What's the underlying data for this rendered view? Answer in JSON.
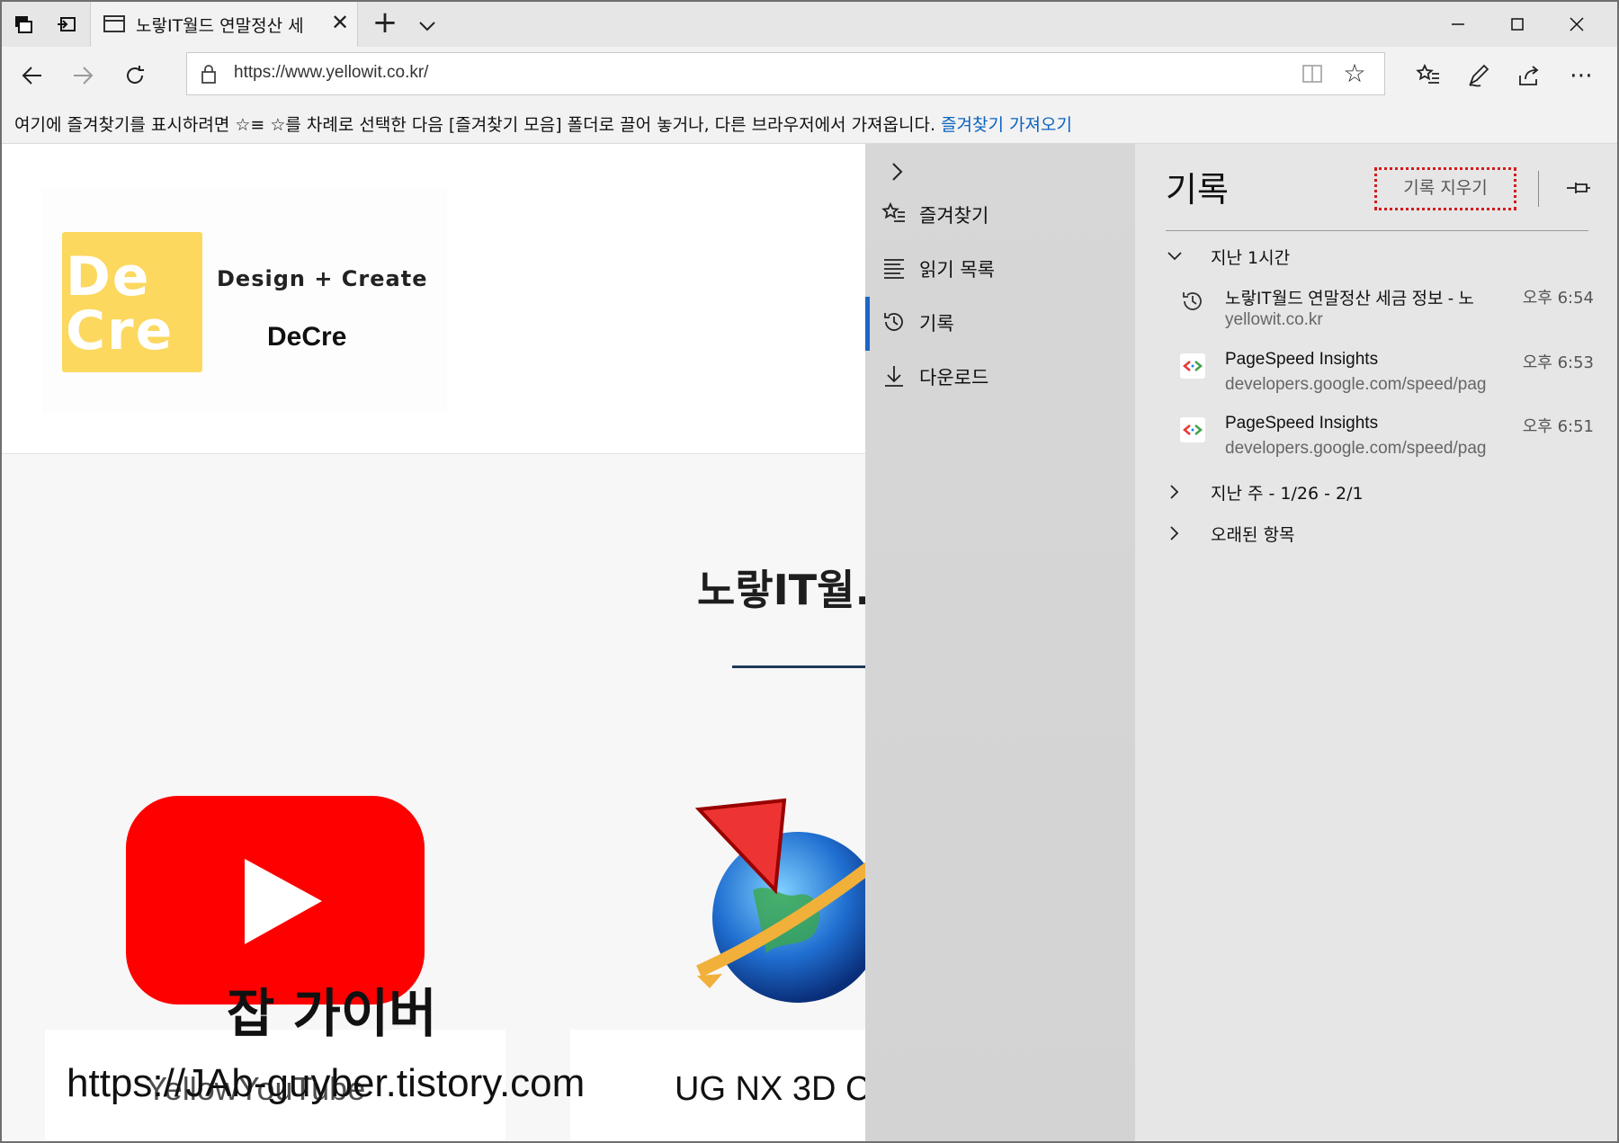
{
  "browser": {
    "tab_title": "노랗IT월드 연말정산 세",
    "url": "https://www.yellowit.co.kr/",
    "favorites_hint": "여기에 즐겨찾기를 표시하려면 ☆≡ ☆를 차례로 선택한 다음 [즐겨찾기 모음] 폴더로 끌어 놓거나, 다른 브라우저에서 가져옵니다.",
    "favorites_import": "즐겨찾기 가져오기",
    "icons": [
      "tab-actions-icon",
      "set-aside-icon",
      "page-icon",
      "close-icon",
      "plus-icon",
      "chevron-down-icon",
      "minimize-icon",
      "maximize-icon",
      "window-close-icon",
      "back-icon",
      "forward-icon",
      "refresh-icon",
      "lock-icon",
      "reading-view-icon",
      "star-icon",
      "favorites-hub-icon",
      "pen-icon",
      "share-icon",
      "more-icon"
    ]
  },
  "page": {
    "logo_letters": "De Cre",
    "logo_tag": "Design + Create",
    "logo_name": "DeCre",
    "section_title": "노랗IT월.",
    "yt_caption": "잡 가이버",
    "card1_text": "YellowYouTube",
    "watermark": "https://JAb-guyber.tistory.com",
    "card2_text": "UG NX 3D C",
    "accent": "#fcd85f",
    "youtube_red": "#ff0000"
  },
  "hub": {
    "nav": [
      {
        "label": "즐겨찾기",
        "icon": "favorites-icon"
      },
      {
        "label": "읽기 목록",
        "icon": "reading-list-icon"
      },
      {
        "label": "기록",
        "icon": "history-icon"
      },
      {
        "label": "다운로드",
        "icon": "download-icon"
      }
    ],
    "title": "기록",
    "clear_label": "기록 지우기",
    "groups": [
      {
        "label": "지난 1시간",
        "expanded": true
      },
      {
        "label": "지난 주 - 1/26 - 2/1",
        "expanded": false
      },
      {
        "label": "오래된 항목",
        "expanded": false
      }
    ],
    "entries": [
      {
        "title": "노랗IT월드 연말정산 세금 정보 - 노",
        "url": "yellowit.co.kr",
        "time": "오후 6:54",
        "icon": "history-icon"
      },
      {
        "title": "PageSpeed Insights",
        "url": "developers.google.com/speed/pag",
        "time": "오후 6:53",
        "icon": "pagespeed-icon"
      },
      {
        "title": "PageSpeed Insights",
        "url": "developers.google.com/speed/pag",
        "time": "오후 6:51",
        "icon": "pagespeed-icon"
      }
    ],
    "active_color": "#1e66c8",
    "clear_border_color": "#d21c1c"
  }
}
